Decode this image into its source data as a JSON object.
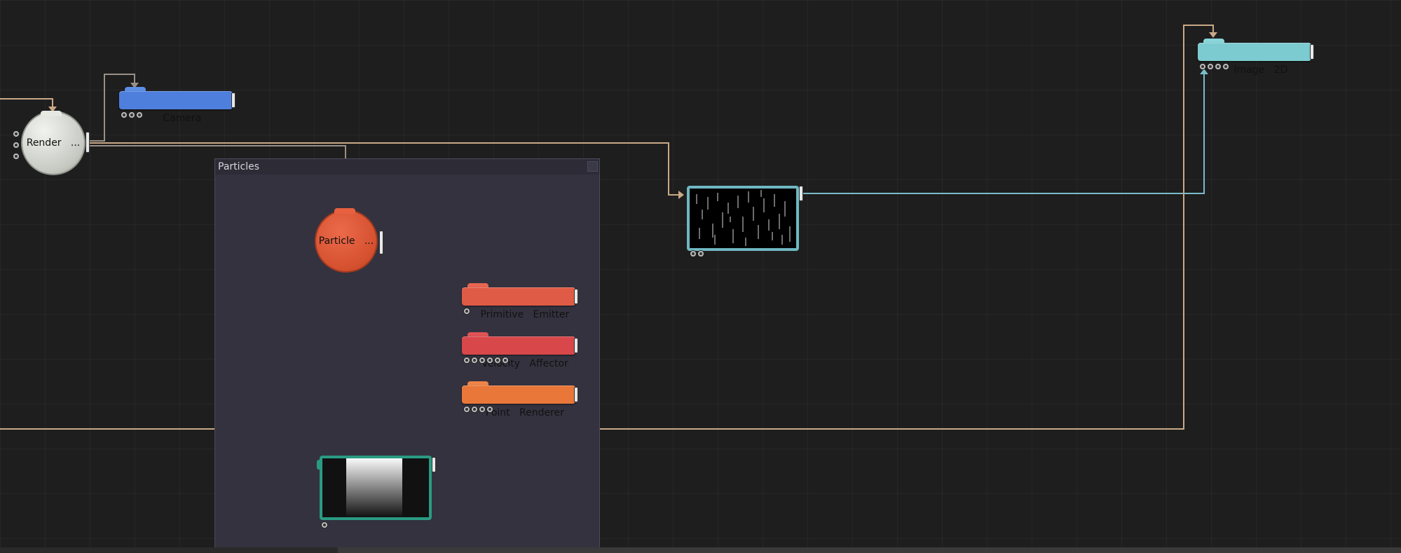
{
  "group": {
    "title": "Particles"
  },
  "nodes": {
    "render": {
      "label": "Render   ...",
      "color": "#d9dcd6"
    },
    "camera": {
      "label": "Camera",
      "color": "#4f7fdc"
    },
    "image2d": {
      "label": "Image   2D",
      "color": "#7ccbd0"
    },
    "particle": {
      "label": "Particle   ...",
      "color": "#e0593a"
    },
    "primitive_emitter": {
      "label": "Primitive   Emitter",
      "color": "#e05b45"
    },
    "velocity_affector": {
      "label": "Velocity   Affector",
      "color": "#d8474a"
    },
    "point_renderer": {
      "label": "Point   Renderer",
      "color": "#e9773a"
    }
  },
  "colors": {
    "wire_tan": "#c9a986",
    "wire_teal": "#79bcc9",
    "wire_gray": "#9a8f86"
  }
}
